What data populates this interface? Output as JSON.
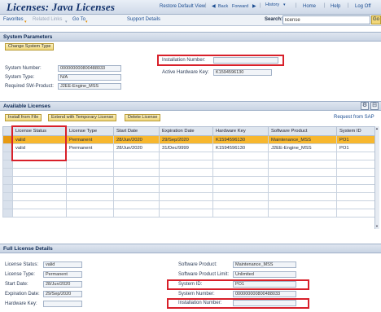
{
  "header": {
    "title": "Licenses: Java Licenses",
    "links": [
      "Restore Default View",
      "Back",
      "Forward",
      "History",
      "Home",
      "Help",
      "Log Off"
    ]
  },
  "toolbar": {
    "favorites": "Favorites",
    "related_links": "Related Links",
    "go_to": "Go To",
    "support_details": "Support Details",
    "search_label": "Search:",
    "search_value": "license",
    "go_label": "Go"
  },
  "system_parameters": {
    "title": "System Parameters",
    "change_button": "Change System Type",
    "system_number_label": "System Number:",
    "system_number": "000000000800488033",
    "system_type_label": "System Type:",
    "system_type": "N/A",
    "required_product_label": "Required SW-Product:",
    "required_product": "J2EE-Engine_MSS",
    "installation_number_label": "Installation Number:",
    "installation_number": "",
    "hardware_key_label": "Active Hardware Key:",
    "hardware_key": "K1594596130"
  },
  "available_licenses": {
    "title": "Available Licenses",
    "buttons": [
      "Install from File",
      "Extend with Temporary License",
      "Delete License"
    ],
    "request_link": "Request from SAP",
    "columns": [
      "License Status",
      "License Type",
      "Start Date",
      "Expiration Date",
      "Hardware Key",
      "Software Product",
      "System ID"
    ],
    "rows": [
      [
        "valid",
        "Permanent",
        "28/Jun/2020",
        "29/Sep/2020",
        "K1594596130",
        "Maintenance_MSS",
        "PO1"
      ],
      [
        "valid",
        "Permanent",
        "28/Jun/2020",
        "31/Dec/9999",
        "K1594596130",
        "J2EE-Engine_MSS",
        "PO1"
      ]
    ]
  },
  "full_details": {
    "title": "Full License Details",
    "license_status_label": "License Status:",
    "license_status": "valid",
    "license_type_label": "License Type:",
    "license_type": "Permanent",
    "start_date_label": "Start Date:",
    "start_date": "28/Jun/2020",
    "expiration_date_label": "Expiration Date:",
    "expiration_date": "29/Sep/2020",
    "hardware_key_label": "Hardware Key:",
    "hardware_key": "",
    "software_product_label": "Software Product:",
    "software_product": "Maintenance_MSS",
    "product_limit_label": "Software Product Limit:",
    "product_limit": "Unlimited",
    "system_id_label": "System ID:",
    "system_id": "PO1",
    "system_number_label": "System Number:",
    "system_number": "000000000800488033",
    "installation_number_label": "Installation Number:",
    "installation_number": ""
  },
  "colors": {
    "highlight_box": "#d8202a",
    "selected_row": "#f7b72e",
    "button_fill": "#efd67a"
  }
}
